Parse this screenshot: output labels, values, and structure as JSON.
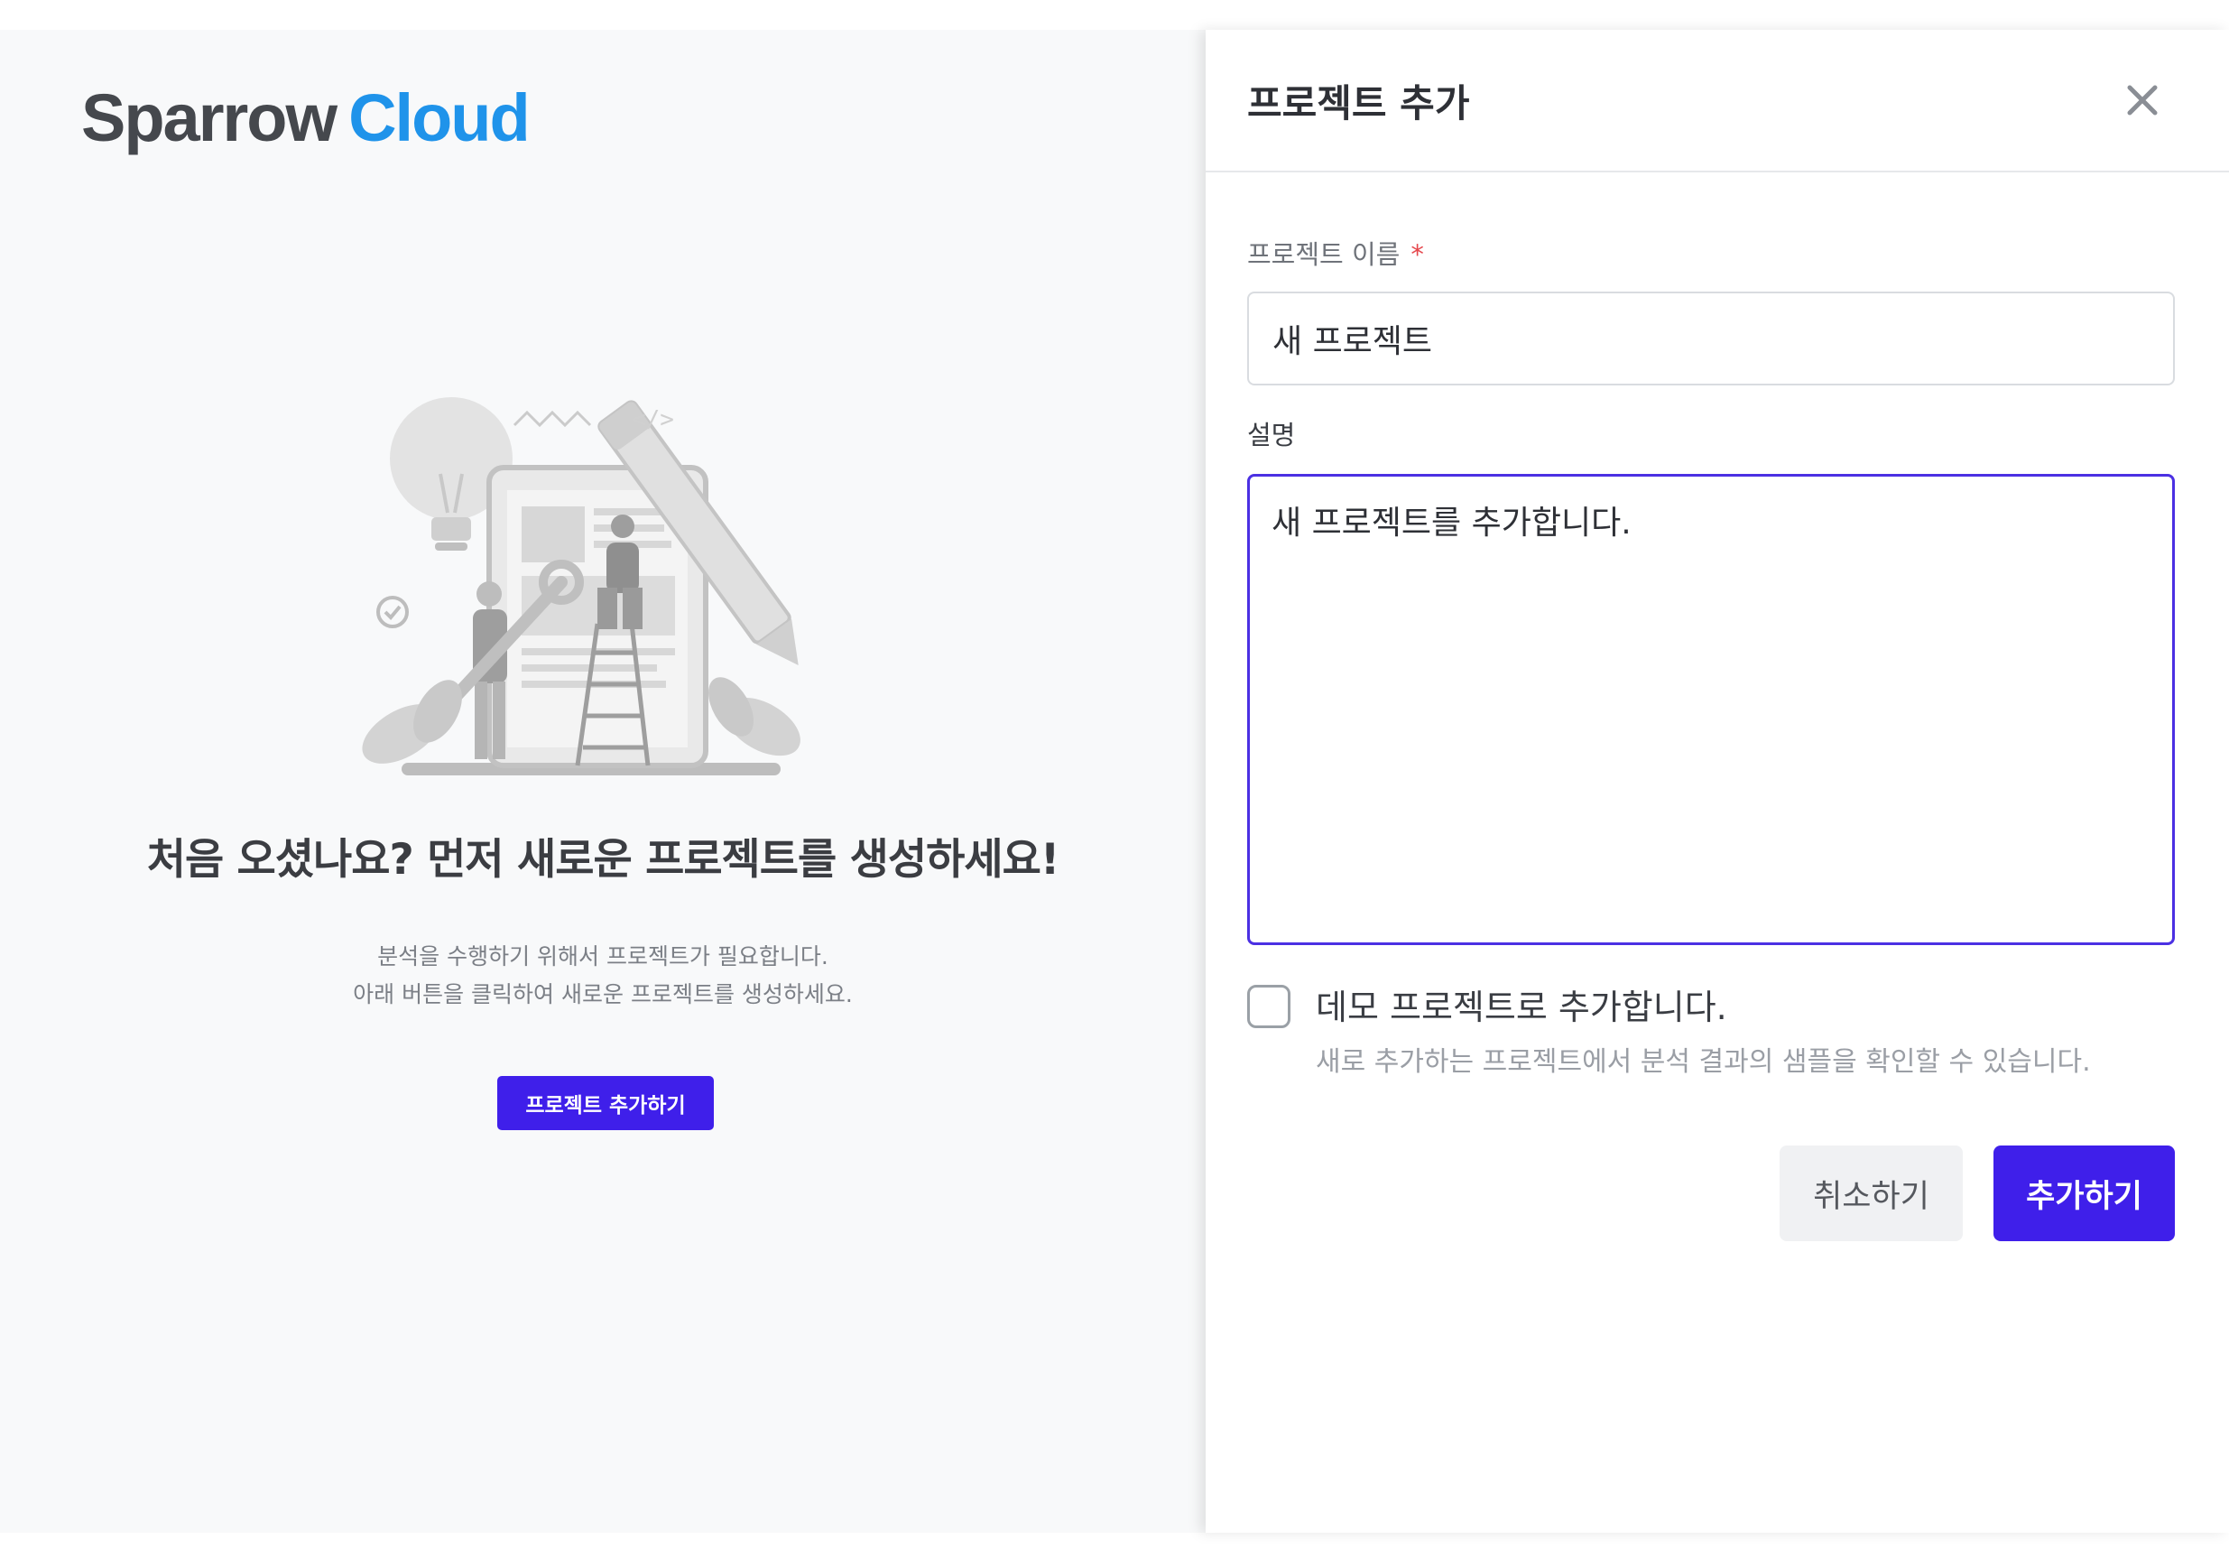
{
  "brand": {
    "name_part1": "Sparrow",
    "name_part2": "Cloud"
  },
  "empty_state": {
    "title": "처음 오셨나요? 먼저 새로운 프로젝트를 생성하세요!",
    "description_line1": "분석을 수행하기 위해서 프로젝트가 필요합니다.",
    "description_line2": "아래 버튼을 클릭하여 새로운 프로젝트를 생성하세요.",
    "add_button_label": "프로젝트 추가하기",
    "illustration": "people-building-project-illustration"
  },
  "drawer": {
    "title": "프로젝트 추가",
    "close_icon": "close-icon",
    "name_field": {
      "label": "프로젝트 이름",
      "required_mark": "*",
      "value": "새 프로젝트"
    },
    "description_field": {
      "label": "설명",
      "value": "새 프로젝트를 추가합니다."
    },
    "demo_option": {
      "label": "데모 프로젝트로 추가합니다.",
      "hint": "새로 추가하는 프로젝트에서 분석 결과의 샘플을 확인할 수 있습니다.",
      "checked": false
    },
    "cancel_label": "취소하기",
    "submit_label": "추가하기"
  },
  "colors": {
    "primary": "#3f1fea",
    "brand_blue": "#1f93ea",
    "brand_gray": "#45484d",
    "required": "#e5484d",
    "page_bg": "#f8f9fa"
  }
}
